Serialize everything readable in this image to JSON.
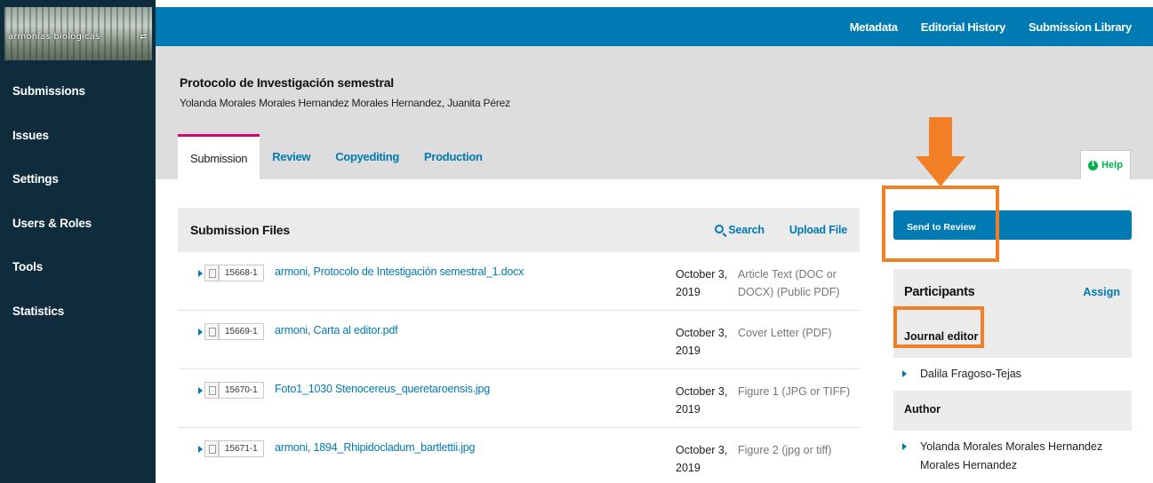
{
  "sidebar": {
    "logo_text": "armonías biológicas",
    "items": [
      {
        "label": "Submissions"
      },
      {
        "label": "Issues"
      },
      {
        "label": "Settings"
      },
      {
        "label": "Users & Roles"
      },
      {
        "label": "Tools"
      },
      {
        "label": "Statistics"
      }
    ]
  },
  "topnav": {
    "metadata": "Metadata",
    "editorial_history": "Editorial History",
    "submission_library": "Submission Library"
  },
  "submission": {
    "title": "Protocolo de Investigación semestral",
    "authors": "Yolanda Morales Morales Hernandez Morales Hernandez, Juanita Pérez"
  },
  "tabs": [
    {
      "label": "Submission",
      "active": true
    },
    {
      "label": "Review"
    },
    {
      "label": "Copyediting"
    },
    {
      "label": "Production"
    }
  ],
  "help": {
    "label": "Help",
    "icon": "info-icon"
  },
  "files": {
    "title": "Submission Files",
    "search_label": "Search",
    "upload_label": "Upload File",
    "rows": [
      {
        "id": "15668-1",
        "name": "armoni, Protocolo de Intestigación semestral_1.docx",
        "date": "October 3, 2019",
        "type": "Article Text (DOC or DOCX) (Public PDF)"
      },
      {
        "id": "15669-1",
        "name": "armoni, Carta al editor.pdf",
        "date": "October 3, 2019",
        "type": "Cover Letter (PDF)"
      },
      {
        "id": "15670-1",
        "name": "Foto1_1030 Stenocereus_queretaroensis.jpg",
        "date": "October 3, 2019",
        "type": "Figure 1 (JPG or TIFF)"
      },
      {
        "id": "15671-1",
        "name": "armoni, 1894_Rhipidocladum_bartlettii.jpg",
        "date": "October 3, 2019",
        "type": "Figure 2 (jpg or tiff)"
      }
    ]
  },
  "actions": {
    "send_to_review": "Send to Review"
  },
  "participants": {
    "title": "Participants",
    "assign_label": "Assign",
    "roles": [
      {
        "role": "Journal editor",
        "people": [
          "Dalila Fragoso-Tejas"
        ]
      },
      {
        "role": "Author",
        "people": [
          "Yolanda Morales Morales Hernandez Morales Hernandez"
        ]
      }
    ]
  },
  "colors": {
    "sidebar_bg": "#0f2c3c",
    "topbar_bg": "#007ab2",
    "accent_link": "#007ab2",
    "active_tab_border": "#d00a6c",
    "annotation_orange": "#f27e26",
    "help_green": "#00b24e"
  }
}
